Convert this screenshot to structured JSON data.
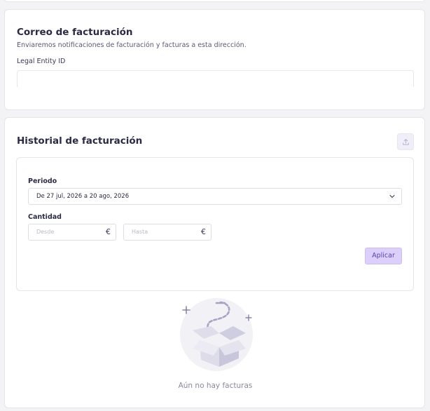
{
  "email_section": {
    "title": "Correo de facturación",
    "description": "Enviaremos notificaciones de facturación y facturas a esta dirección.",
    "legal_entity_label": "Legal Entity ID",
    "legal_entity_value": ""
  },
  "history_section": {
    "title": "Historial de facturación",
    "export_icon": "upload-icon",
    "filters": {
      "period_label": "Periodo",
      "period_value": "De 27 jul, 2026 a 20 ago, 2026",
      "amount_label": "Cantidad",
      "from_placeholder": "Desde",
      "to_placeholder": "Hasta",
      "currency_symbol": "€",
      "apply_label": "Aplicar"
    },
    "empty_state": {
      "icon": "empty-box-icon",
      "message": "Aún no hay facturas"
    }
  },
  "colors": {
    "accent": "#dcd0fb",
    "accent_text": "#5b3fb4",
    "background": "#f3f3f6",
    "card": "#ffffff"
  }
}
